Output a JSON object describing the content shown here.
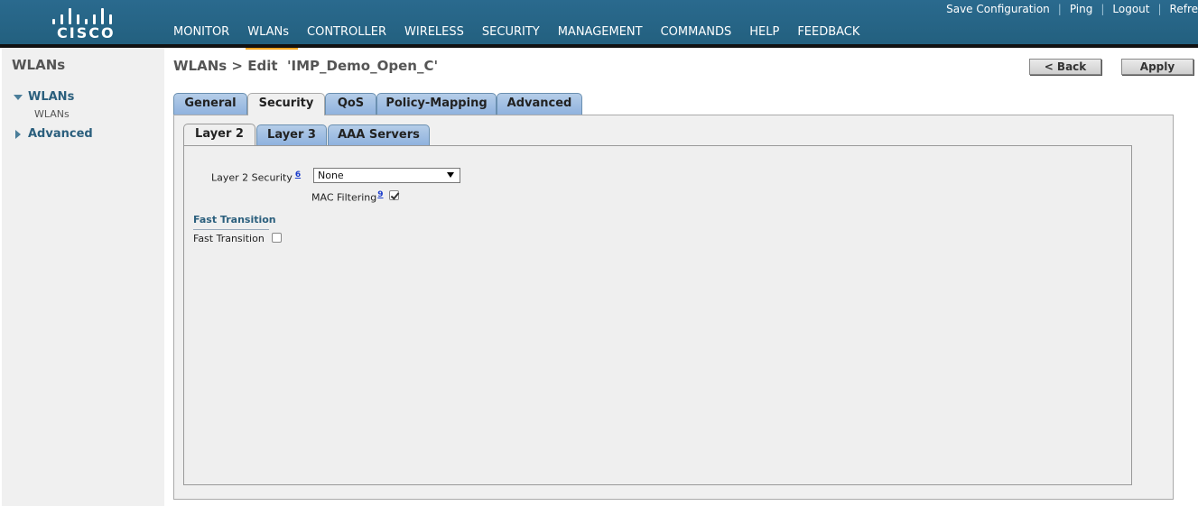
{
  "header": {
    "brand": "CISCO",
    "nav": [
      "MONITOR",
      "WLANs",
      "CONTROLLER",
      "WIRELESS",
      "SECURITY",
      "MANAGEMENT",
      "COMMANDS",
      "HELP",
      "FEEDBACK"
    ],
    "active_nav": "WLANs",
    "links": [
      "Save Configuration",
      "Ping",
      "Logout",
      "Refre"
    ]
  },
  "sidebar": {
    "title": "WLANs",
    "items": [
      {
        "label": "WLANs",
        "expanded": true,
        "children": [
          "WLANs"
        ]
      },
      {
        "label": "Advanced",
        "expanded": false
      }
    ]
  },
  "page": {
    "title": "WLANs > Edit  'IMP_Demo_Open_C'",
    "back_label": "< Back",
    "apply_label": "Apply"
  },
  "tabs": [
    "General",
    "Security",
    "QoS",
    "Policy-Mapping",
    "Advanced"
  ],
  "active_tab": "Security",
  "subtabs": [
    "Layer 2",
    "Layer 3",
    "AAA Servers"
  ],
  "active_subtab": "Layer 2",
  "form": {
    "layer2_security_label": "Layer 2 Security",
    "layer2_security_footnote": "6",
    "layer2_security_value": "None",
    "mac_filtering_label": "MAC Filtering",
    "mac_filtering_footnote": "9",
    "mac_filtering_checked": true,
    "fast_transition_section": "Fast Transition",
    "fast_transition_label": "Fast Transition",
    "fast_transition_checked": false
  },
  "icons": {
    "logo": "cisco-logo",
    "tree_expanded": "triangle-down-icon",
    "tree_collapsed": "triangle-right-icon",
    "select_caret": "dropdown-caret-icon",
    "checkbox_checked": "checkmark-icon"
  },
  "colors": {
    "header": "#23607f",
    "active_nav_underline": "#f5a623",
    "tab_fill": "#8fb2de",
    "link": "#1a3ccc",
    "section_heading": "#2b5f7d"
  }
}
